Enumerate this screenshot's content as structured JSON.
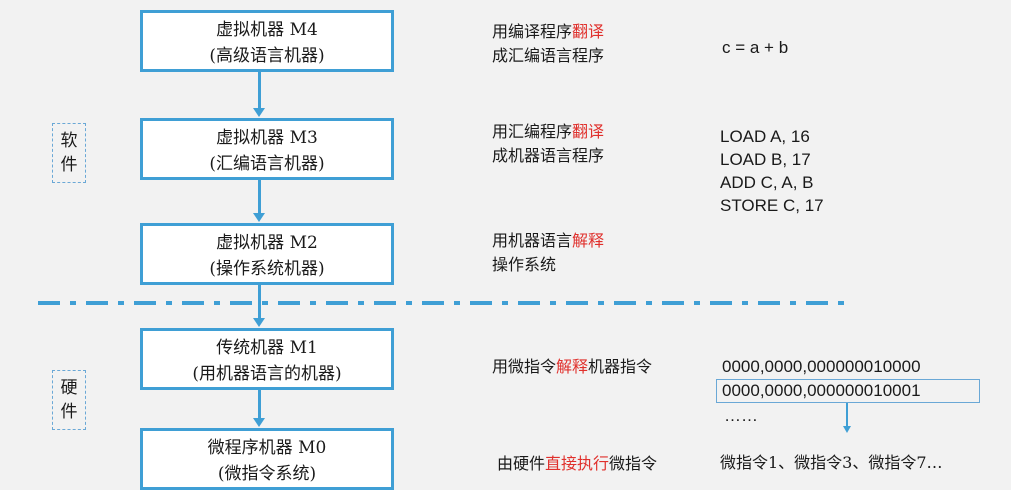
{
  "levels": [
    {
      "name": "虚拟机器 M4",
      "sub": "(高级语言机器)",
      "desc_parts": [
        "用编译程序",
        "翻译",
        "成汇编语言程序"
      ]
    },
    {
      "name": "虚拟机器 M3",
      "sub": "(汇编语言机器)",
      "desc_parts": [
        "用汇编程序",
        "翻译",
        "成机器语言程序"
      ]
    },
    {
      "name": "虚拟机器 M2",
      "sub": "(操作系统机器)",
      "desc_parts": [
        "用机器语言",
        "解释",
        "操作系统"
      ]
    },
    {
      "name": "传统机器 M1",
      "sub": "(用机器语言的机器)",
      "desc_parts": [
        "用微指令",
        "解释",
        "机器指令"
      ]
    },
    {
      "name": "微程序机器 M0",
      "sub": "(微指令系统)",
      "desc_parts": [
        "由硬件",
        "直接执行",
        "微指令"
      ]
    }
  ],
  "side_labels": {
    "software": [
      "软",
      "件"
    ],
    "hardware": [
      "硬",
      "件"
    ]
  },
  "examples": {
    "high_level": "c = a + b",
    "assembly": [
      "LOAD A, 16",
      "LOAD B, 17",
      "ADD C, A, B",
      "STORE C, 17"
    ],
    "machine": [
      "0000,0000,000000010000",
      "0000,0000,000000010001",
      "……"
    ],
    "micro": "微指令1、微指令3、微指令7…"
  },
  "colors": {
    "accent": "#3f9fd5",
    "highlight": "#e0302c"
  }
}
